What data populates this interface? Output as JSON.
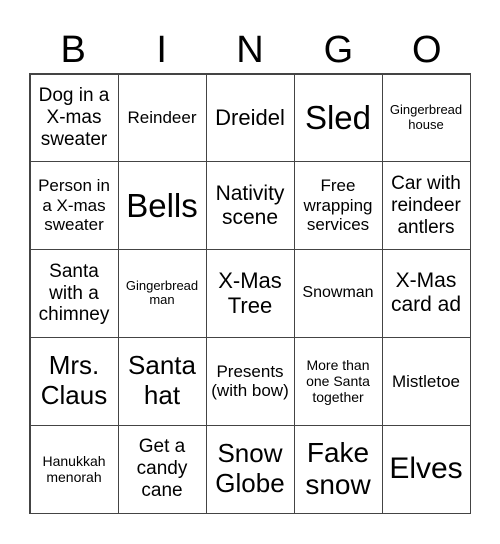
{
  "header": {
    "letters": [
      "B",
      "I",
      "N",
      "G",
      "O"
    ]
  },
  "cells": [
    "Dog in a X-mas sweater",
    "Reindeer",
    "Dreidel",
    "Sled",
    "Gingerbread house",
    "Person in a X-mas sweater",
    "Bells",
    "Nativity scene",
    "Free wrapping services",
    "Car with reindeer antlers",
    "Santa with a chimney",
    "Gingerbread man",
    "X-Mas Tree",
    "Snowman",
    "X-Mas card ad",
    "Mrs. Claus",
    "Santa hat",
    "Presents (with bow)",
    "More than one Santa together",
    "Mistletoe",
    "Hanukkah menorah",
    "Get a candy cane",
    "Snow Globe",
    "Fake snow",
    "Elves"
  ]
}
